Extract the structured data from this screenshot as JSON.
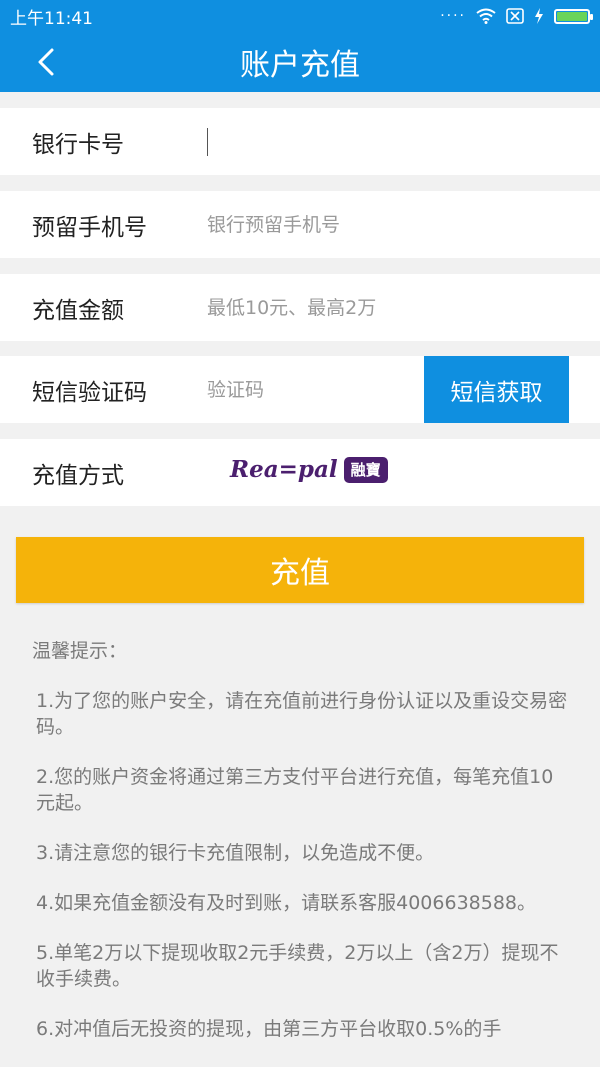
{
  "status_bar": {
    "time": "上午11:41",
    "signal_dots": "····",
    "battery_level": 0.95
  },
  "nav": {
    "title": "账户充值"
  },
  "form": {
    "card_label": "银行卡号",
    "card_value": "",
    "phone_label": "预留手机号",
    "phone_placeholder": "银行预留手机号",
    "amount_label": "充值金额",
    "amount_placeholder": "最低10元、最高2万",
    "sms_label": "短信验证码",
    "sms_placeholder": "验证码",
    "sms_button": "短信获取",
    "method_label": "充值方式",
    "method_logo_text": "Rea=pal",
    "method_logo_badge": "融寶"
  },
  "submit_label": "充值",
  "tips": {
    "title": "温馨提示：",
    "items": [
      "1.为了您的账户安全，请在充值前进行身份认证以及重设交易密码。",
      "2.您的账户资金将通过第三方支付平台进行充值，每笔充值10元起。",
      "3.请注意您的银行卡充值限制，以免造成不便。",
      "4.如果充值金额没有及时到账，请联系客服4006638588。",
      "5.单笔2万以下提现收取2元手续费，2万以上（含2万）提现不收手续费。",
      "6.对冲值后无投资的提现，由第三方平台收取0.5%的手"
    ]
  },
  "colors": {
    "primary": "#0f8fe0",
    "accent": "#f5b30a",
    "brand": "#4b1f6e"
  }
}
